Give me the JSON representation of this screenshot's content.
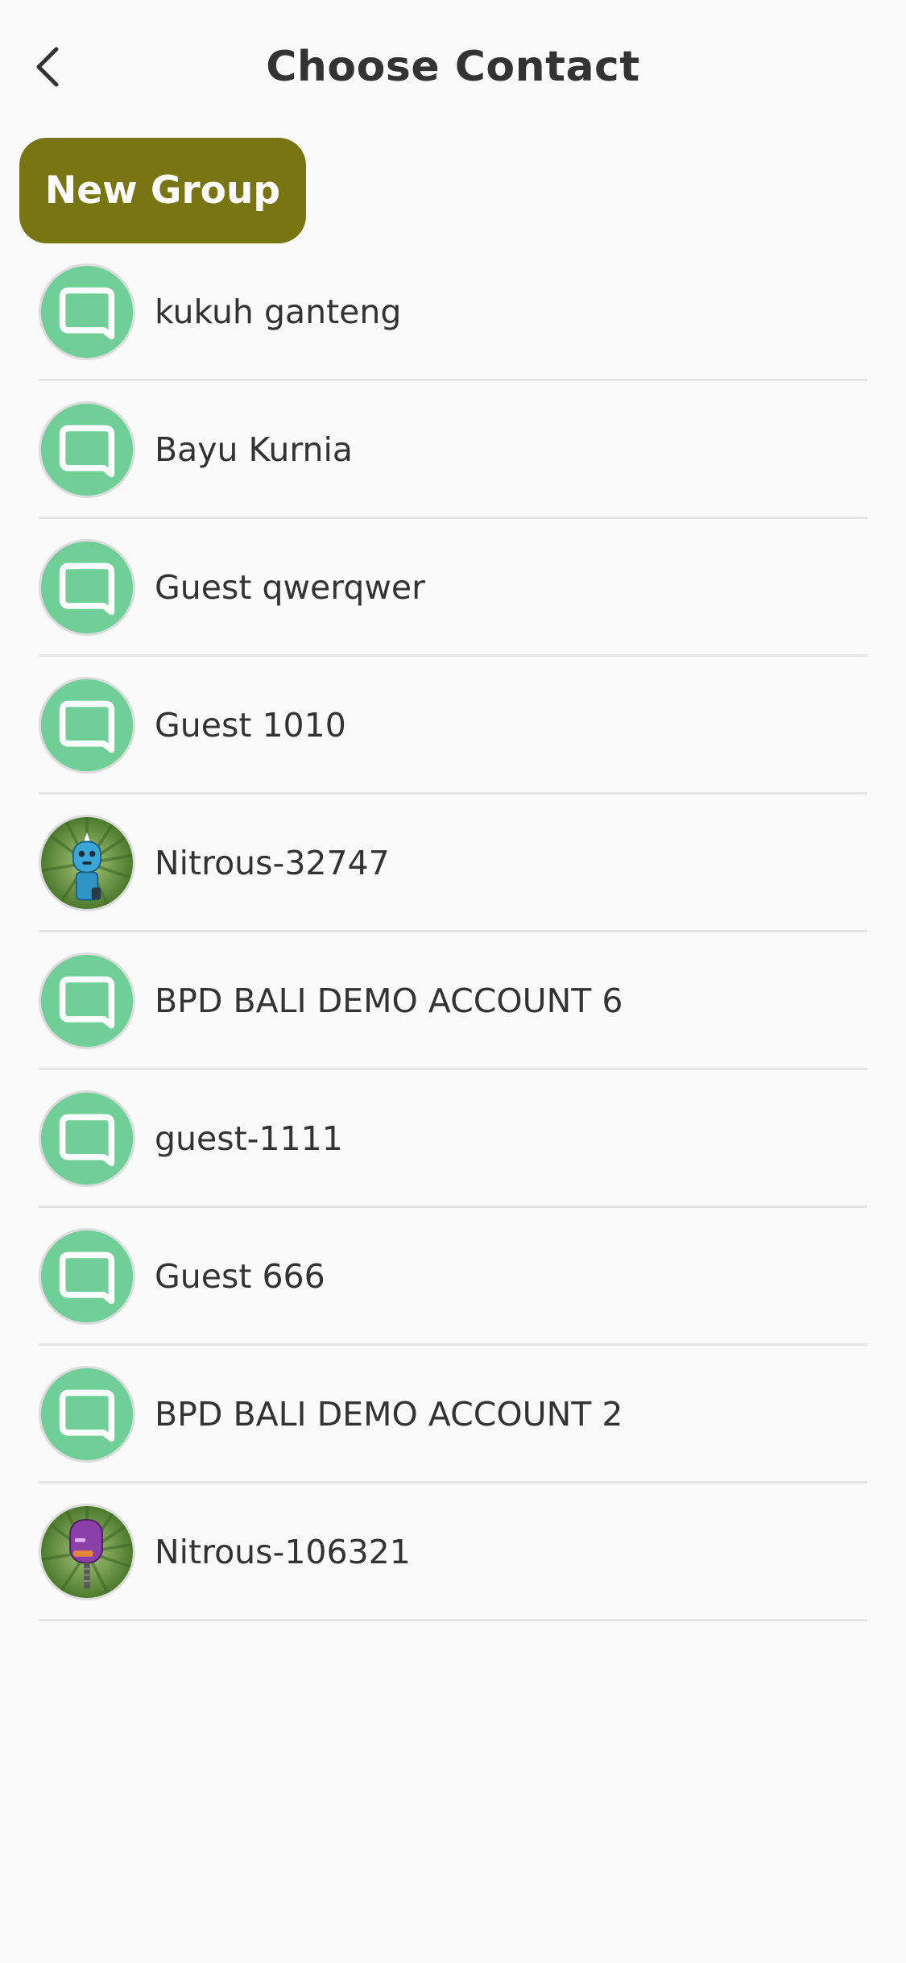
{
  "header": {
    "title": "Choose Contact"
  },
  "actions": {
    "new_group_label": "New Group"
  },
  "contacts": [
    {
      "name": "kukuh ganteng",
      "avatar": "chat-bubble-icon"
    },
    {
      "name": "Bayu Kurnia",
      "avatar": "chat-bubble-icon"
    },
    {
      "name": "Guest qwerqwer",
      "avatar": "chat-bubble-icon"
    },
    {
      "name": "Guest 1010",
      "avatar": "chat-bubble-icon"
    },
    {
      "name": "Nitrous-32747",
      "avatar": "robot-avatar-blue"
    },
    {
      "name": "BPD BALI DEMO ACCOUNT 6",
      "avatar": "chat-bubble-icon"
    },
    {
      "name": "guest-1111",
      "avatar": "chat-bubble-icon"
    },
    {
      "name": "Guest 666",
      "avatar": "chat-bubble-icon"
    },
    {
      "name": "BPD BALI DEMO ACCOUNT 2",
      "avatar": "chat-bubble-icon"
    },
    {
      "name": "Nitrous-106321",
      "avatar": "robot-avatar-purple"
    }
  ],
  "colors": {
    "accent": "#797512",
    "avatar_green": "#6fcf97",
    "background": "#fafafa",
    "text": "#333333",
    "divider": "#e4e4e4"
  }
}
